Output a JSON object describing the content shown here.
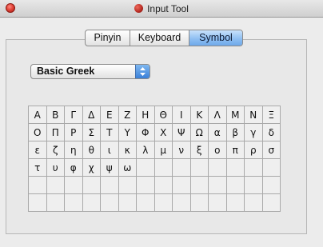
{
  "window": {
    "title": "Input Tool",
    "icons": {
      "close": "close-circle-icon",
      "app": "input-tool-app-icon"
    }
  },
  "tabs": [
    {
      "label": "Pinyin",
      "active": false
    },
    {
      "label": "Keyboard",
      "active": false
    },
    {
      "label": "Symbol",
      "active": true
    }
  ],
  "symbol_set": {
    "selected": "Basic Greek",
    "icon": "up-down-arrows-icon"
  },
  "grid": {
    "columns": 14,
    "rows": 6,
    "symbols": [
      "Α",
      "Β",
      "Γ",
      "Δ",
      "Ε",
      "Ζ",
      "Η",
      "Θ",
      "Ι",
      "Κ",
      "Λ",
      "Μ",
      "Ν",
      "Ξ",
      "Ο",
      "Π",
      "Ρ",
      "Σ",
      "Τ",
      "Υ",
      "Φ",
      "Χ",
      "Ψ",
      "Ω",
      "α",
      "β",
      "γ",
      "δ",
      "ε",
      "ζ",
      "η",
      "θ",
      "ι",
      "κ",
      "λ",
      "μ",
      "ν",
      "ξ",
      "ο",
      "π",
      "ρ",
      "σ",
      "τ",
      "υ",
      "φ",
      "χ",
      "ψ",
      "ω"
    ]
  },
  "colors": {
    "accent": "#6fa9ea",
    "close_button": "#e2453a"
  }
}
